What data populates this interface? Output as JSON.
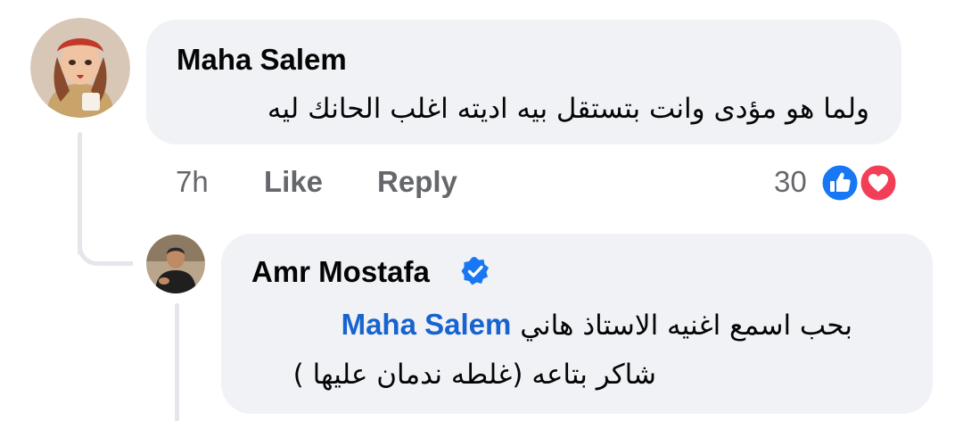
{
  "comments": [
    {
      "author": "Maha Salem",
      "text": "ولما هو مؤدى وانت بتستقل بيه اديته اغلب الحانك ليه",
      "time": "7h",
      "like_label": "Like",
      "reply_label": "Reply",
      "reaction_count": "30",
      "reactions": [
        "like-icon",
        "love-icon"
      ]
    }
  ],
  "reply": {
    "author": "Amr Mostafa",
    "verified": true,
    "mention": "Maha Salem",
    "text_line1": "بحب اسمع اغنيه الاستاذ هاني",
    "text_line2": "شاكر بتاعه (غلطه ندمان عليها )"
  },
  "colors": {
    "bubble": "#f0f2f5",
    "mention": "#1763cf",
    "meta": "#65676b",
    "like_blue": "#1877f2",
    "love_red": "#f33e58"
  }
}
